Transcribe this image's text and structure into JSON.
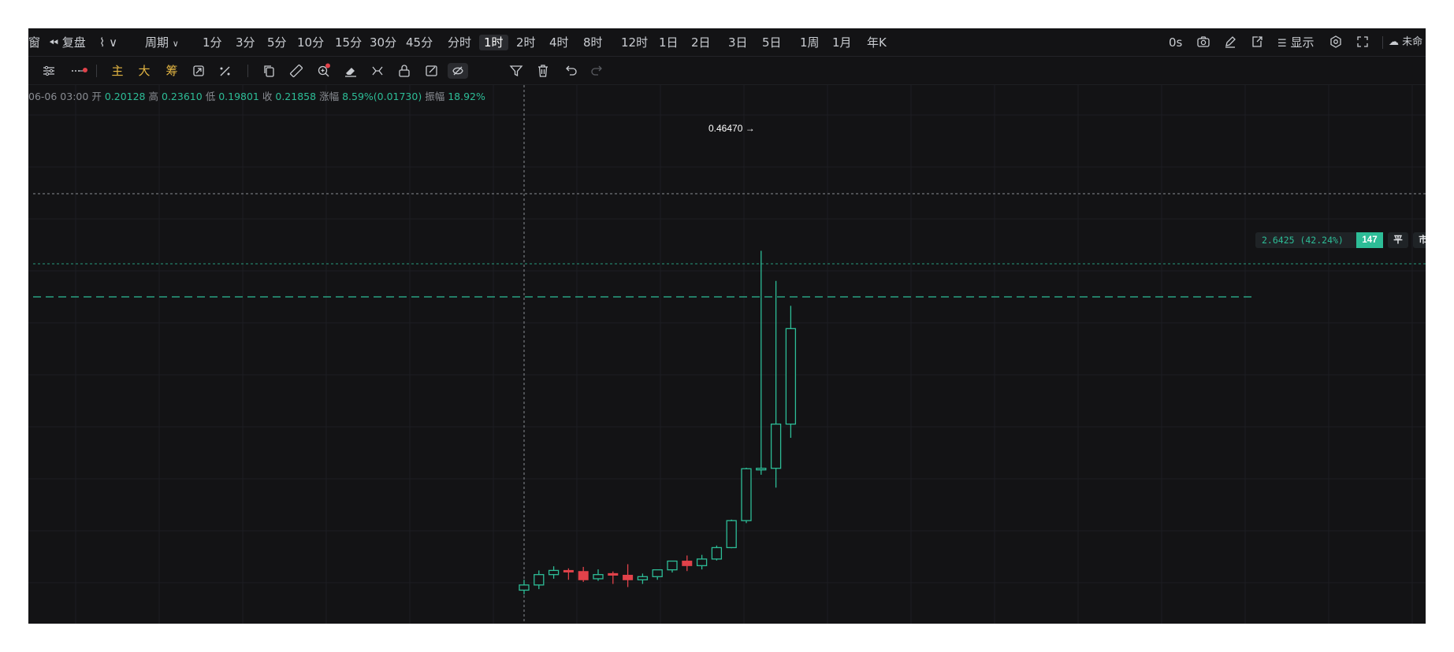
{
  "topbar": {
    "left_partial": "窗",
    "replay_label": "复盘",
    "indicator_glyph": "⌇",
    "period_label": "周期",
    "intervals": [
      {
        "label": "1分"
      },
      {
        "label": "3分"
      },
      {
        "label": "5分"
      },
      {
        "label": "10分"
      },
      {
        "label": "15分"
      },
      {
        "label": "30分"
      },
      {
        "label": "45分"
      },
      {
        "label": "分时"
      },
      {
        "label": "1时",
        "active": true
      },
      {
        "label": "2时"
      },
      {
        "label": "4时"
      },
      {
        "label": "8时"
      },
      {
        "label": "12时"
      },
      {
        "label": "1日"
      },
      {
        "label": "2日"
      },
      {
        "label": "3日"
      },
      {
        "label": "5日"
      },
      {
        "label": "1周"
      },
      {
        "label": "1月"
      },
      {
        "label": "年K"
      }
    ],
    "countdown": "0s",
    "display_label": "显示",
    "unnamed_label": "未命"
  },
  "drawbar": {
    "main_label": "主",
    "big_label": "大",
    "chip_label": "筹"
  },
  "ohlc": {
    "time": "06-06 03:00",
    "open_label": "开",
    "open": "0.20128",
    "high_label": "高",
    "high": "0.23610",
    "low_label": "低",
    "low": "0.19801",
    "close_label": "收",
    "close": "0.21858",
    "change_label": "涨幅",
    "change": "8.59%(0.01730)",
    "amplitude_label": "振幅",
    "amplitude": "18.92%"
  },
  "chart": {
    "high_marker": "0.46470 →",
    "position_line": {
      "text": "2.6425 (42.24%)",
      "qty": "147",
      "close_btn": "平",
      "market_btn": "市"
    },
    "colors": {
      "up": "#2dbd97",
      "down": "#e1424a",
      "bg": "#131315",
      "grid": "#1d1e22"
    },
    "candles": [
      {
        "o": 0.15,
        "h": 0.2,
        "l": 0.13,
        "c": 0.175
      },
      {
        "o": 0.175,
        "h": 0.245,
        "l": 0.155,
        "c": 0.225
      },
      {
        "o": 0.225,
        "h": 0.265,
        "l": 0.205,
        "c": 0.245
      },
      {
        "o": 0.245,
        "h": 0.255,
        "l": 0.2,
        "c": 0.24
      },
      {
        "o": 0.24,
        "h": 0.262,
        "l": 0.19,
        "c": 0.2
      },
      {
        "o": 0.205,
        "h": 0.25,
        "l": 0.195,
        "c": 0.225
      },
      {
        "o": 0.23,
        "h": 0.24,
        "l": 0.18,
        "c": 0.222
      },
      {
        "o": 0.222,
        "h": 0.275,
        "l": 0.165,
        "c": 0.2
      },
      {
        "o": 0.2,
        "h": 0.23,
        "l": 0.18,
        "c": 0.215
      },
      {
        "o": 0.215,
        "h": 0.248,
        "l": 0.2,
        "c": 0.248
      },
      {
        "o": 0.248,
        "h": 0.29,
        "l": 0.235,
        "c": 0.29
      },
      {
        "o": 0.29,
        "h": 0.317,
        "l": 0.242,
        "c": 0.268
      },
      {
        "o": 0.268,
        "h": 0.32,
        "l": 0.25,
        "c": 0.3
      },
      {
        "o": 0.3,
        "h": 0.365,
        "l": 0.293,
        "c": 0.355
      },
      {
        "o": 0.355,
        "h": 0.49,
        "l": 0.352,
        "c": 0.485
      },
      {
        "o": 0.485,
        "h": 0.74,
        "l": 0.473,
        "c": 0.735
      },
      {
        "o": 0.733,
        "h": 1.785,
        "l": 0.706,
        "c": 0.737
      },
      {
        "o": 0.737,
        "h": 1.64,
        "l": 0.644,
        "c": 0.95
      },
      {
        "o": 0.95,
        "h": 1.52,
        "l": 0.884,
        "c": 1.41
      }
    ]
  }
}
